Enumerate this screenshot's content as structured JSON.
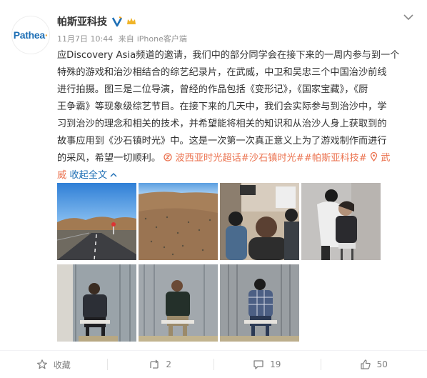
{
  "post": {
    "username": "帕斯亚科技",
    "avatar_text": "Pathea",
    "timestamp": "11月7日 10:44",
    "source_prefix": "来自",
    "source": "iPhone客户端",
    "text_lines": [
      "应Discovery Asia频道的邀请，我们中的部分同学会在接下来的一周内参与到一个",
      "特殊的游戏和治沙相结合的综艺纪录片，在武威，中卫和吴忠三个中国治沙前线",
      "进行拍摄。图三是二位导演，曾经的作品包括《变形记》，《国家宝藏》，《厨",
      "王争霸》等现象级综艺节目。在接下来的几天中，我们会实际参与到治沙中，学",
      "习到治沙的理念和相关的技术，并希望能将相关的知识和从治沙人身上获取到的",
      "故事应用到《沙石镇时光》中。这是一次第一次真正意义上为了游戏制作而进行"
    ],
    "line7_text": "的采风，希望一切顺利。",
    "super_topic": "波西亚时光超话",
    "hashtags": "#沙石镇时光##帕斯亚科技#",
    "location_first": "武",
    "location_rest": "威",
    "collapse_label": "收起全文"
  },
  "footer": {
    "favorite_label": "收藏",
    "repost_count": "2",
    "comment_count": "19",
    "like_count": "50"
  },
  "colors": {
    "link": "#eb7350",
    "verified": "#1e6fb5",
    "muted": "#939393"
  },
  "icons": [
    "verified-icon",
    "crown-icon",
    "chevron-down-icon",
    "location-icon",
    "chevron-up-icon",
    "star-icon",
    "repost-icon",
    "comment-icon",
    "like-icon"
  ]
}
